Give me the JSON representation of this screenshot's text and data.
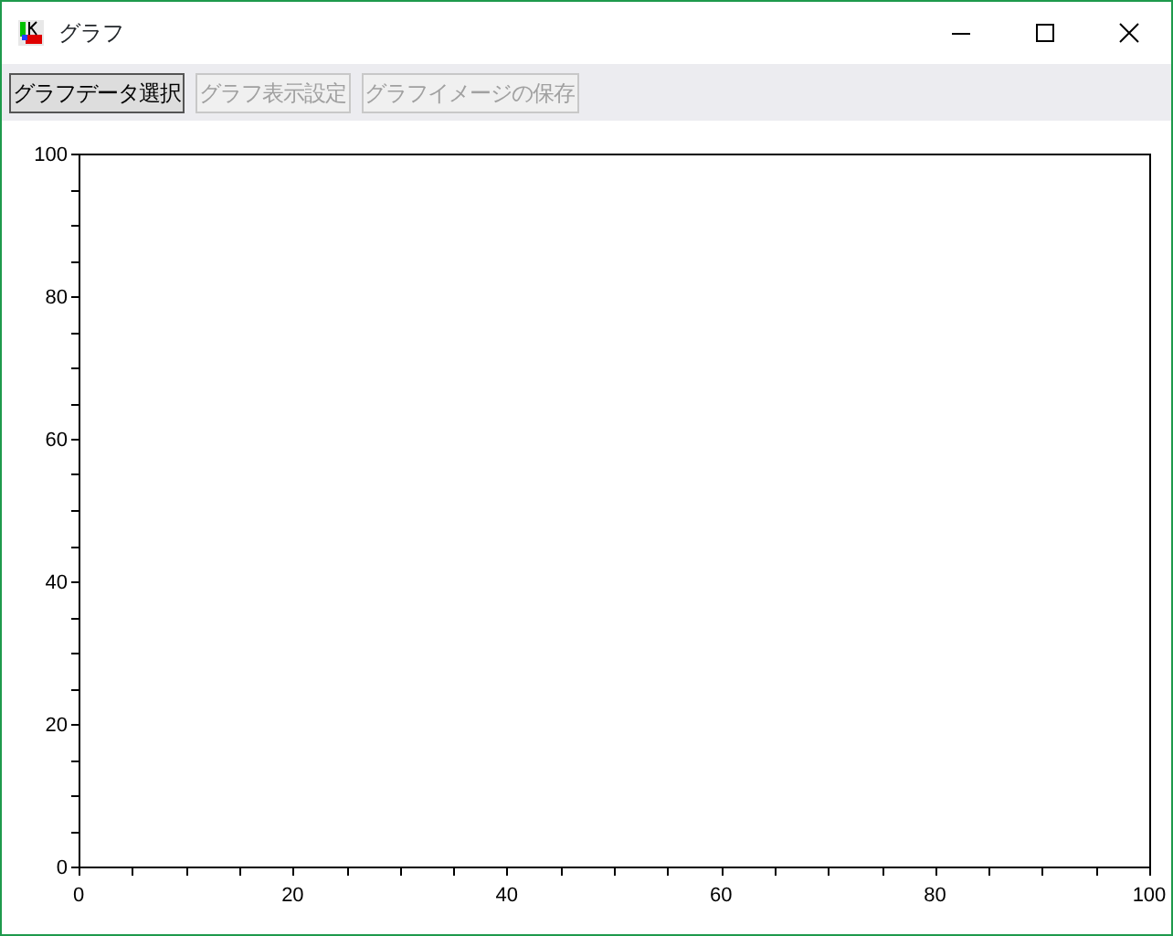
{
  "window": {
    "title": "グラフ"
  },
  "toolbar": [
    {
      "label": "グラフデータ選択",
      "disabled": false
    },
    {
      "label": "グラフ表示設定",
      "disabled": true
    },
    {
      "label": "グラフイメージの保存",
      "disabled": true
    }
  ],
  "chart": {
    "chart_data": {
      "type": "line",
      "xlim": [
        0,
        100
      ],
      "ylim": [
        0,
        100
      ],
      "xticks": [
        0,
        20,
        40,
        60,
        80,
        100
      ],
      "yticks": [
        0,
        20,
        40,
        60,
        80,
        100
      ]
    }
  }
}
